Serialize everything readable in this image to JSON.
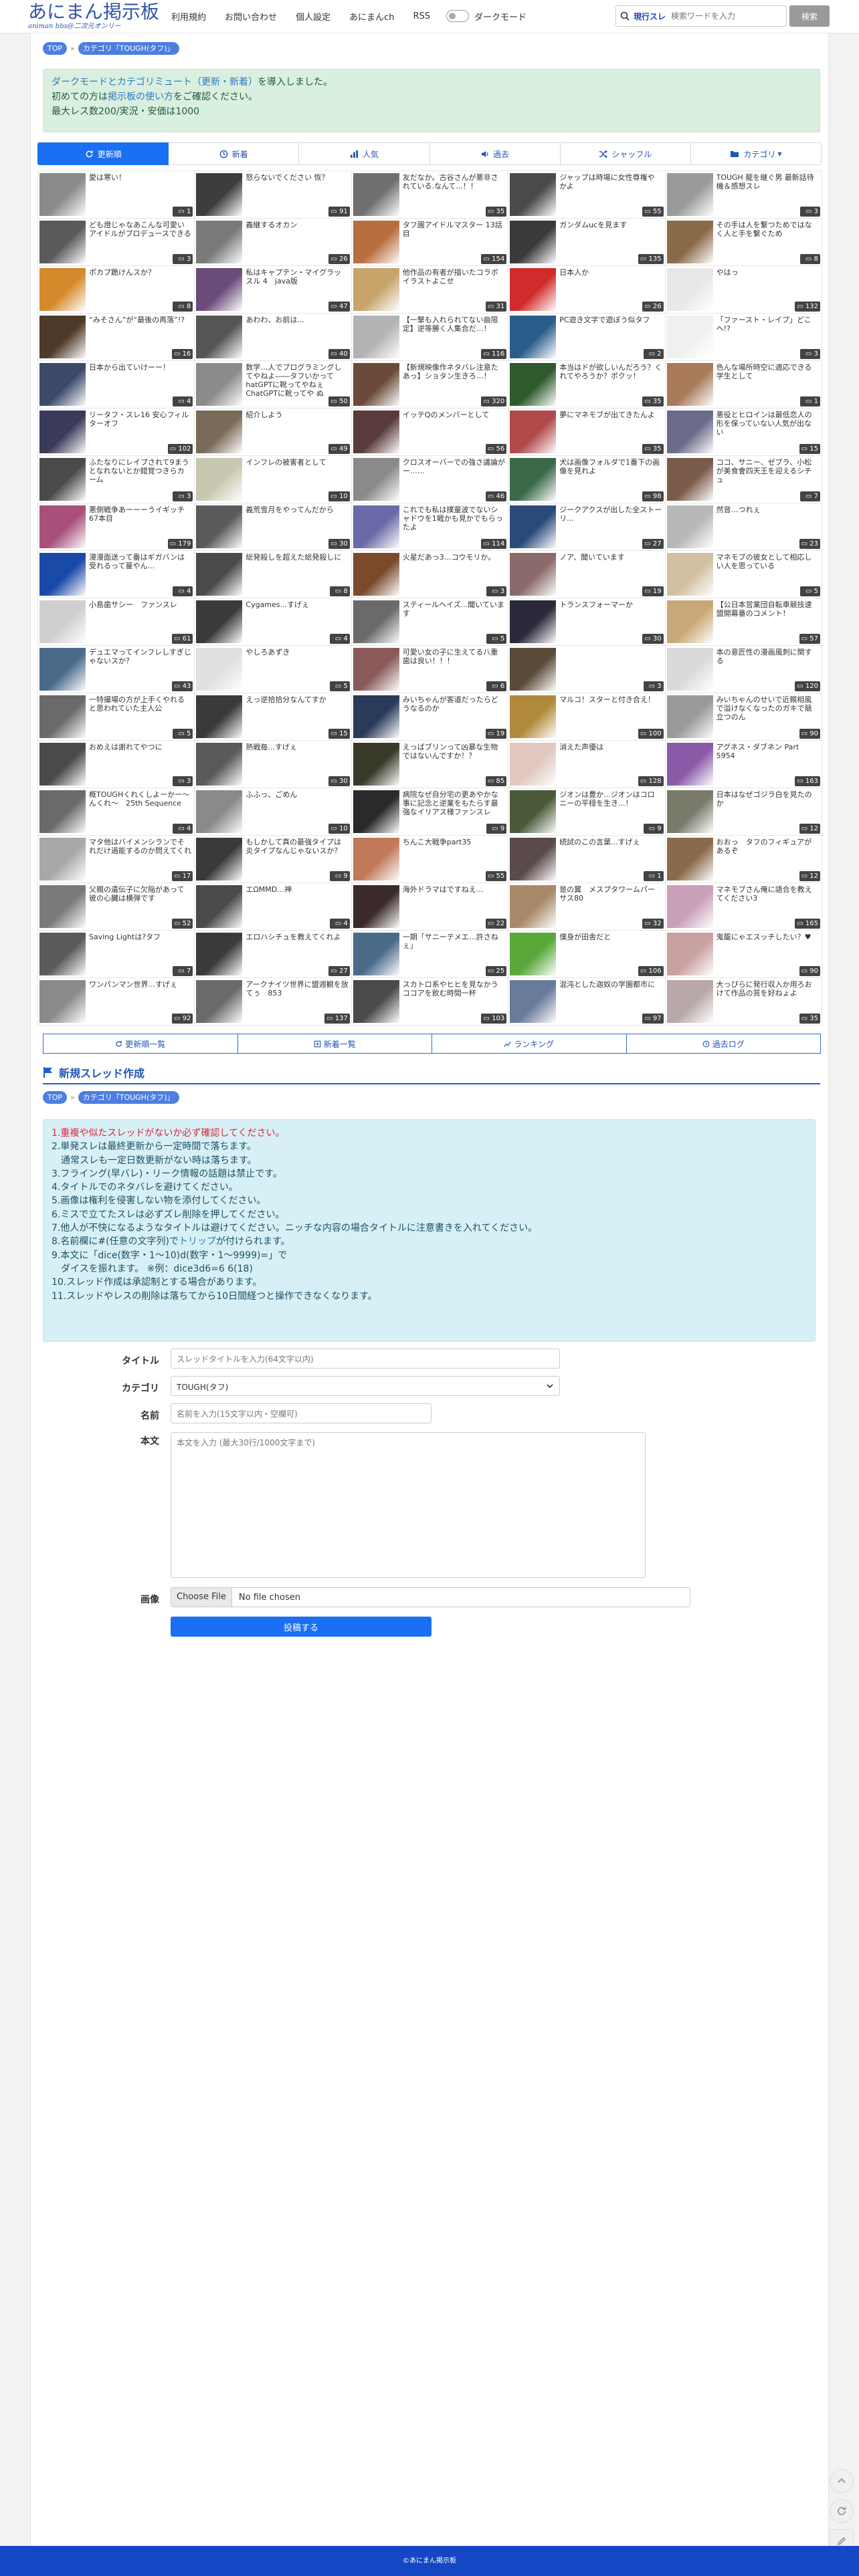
{
  "header": {
    "logo_main": "あにまん掲示板",
    "logo_sub": "animan bbs@二次元オンリー",
    "nav": [
      "利用規約",
      "お問い合わせ",
      "個人設定",
      "あにまんch",
      "RSS"
    ],
    "dark_mode_label": "ダークモード",
    "search_mode": "現行スレ",
    "search_placeholder": "検索ワードを入力",
    "search_button": "検索"
  },
  "breadcrumb": {
    "top": "TOP",
    "category": "カテゴリ「TOUGH(タフ)」"
  },
  "notice": {
    "line1_link": "ダークモードとカテゴリミュート（更新・新着）",
    "line1_rest": "を導入しました。",
    "line2_pre": "初めての方は",
    "line2_link": "掲示板の使い方",
    "line2_rest": "をご確認ください。",
    "line3": "最大レス数200/実況・安価は1000"
  },
  "tabs": [
    "更新順",
    "新着",
    "人気",
    "過去",
    "シャッフル",
    "カテゴリ"
  ],
  "threads": [
    {
      "title": "愛は寒い！",
      "count": "1",
      "thumb": "#8a8a8a"
    },
    {
      "title": "怒らないでください 恢？",
      "count": "91",
      "thumb": "#3d3d3d"
    },
    {
      "title": "友だなか。古谷さんが悪非されている.なんて...！！",
      "count": "35",
      "thumb": "#6f6f6f"
    },
    {
      "title": "ジャップは時場に女性尊権やかよ",
      "count": "55",
      "thumb": "#4a4a4a"
    },
    {
      "title": "TOUGH 龍を継ぐ男 最新話待機＆感想スレ",
      "count": "3",
      "thumb": "#9a9a9a"
    },
    {
      "title": "ども燈じゃなあこんな可愛いアイドルがプロデュースできる",
      "count": "3",
      "thumb": "#5a5a5a"
    },
    {
      "title": "義継するオカン",
      "count": "26",
      "thumb": "#7a7a7a"
    },
    {
      "title": "タフ園アイドルマスター 13話目",
      "count": "154",
      "thumb": "#b86d3c"
    },
    {
      "title": "ガンダムucを見ます",
      "count": "135",
      "thumb": "#3a3a3a"
    },
    {
      "title": "その手は人を繋つためではなく人と手を繋ぐため",
      "count": "8",
      "thumb": "#8b6a4a"
    },
    {
      "title": "ポカプ跪けんスか？",
      "count": "8",
      "thumb": "#d48a2a"
    },
    {
      "title": "私はキャプテン・マイグラッスル 4　java版",
      "count": "47",
      "thumb": "#6a4b7a"
    },
    {
      "title": "他作品の有者が描いたコラボイラストよこせ",
      "count": "31",
      "thumb": "#c7a46a"
    },
    {
      "title": "日本人か",
      "count": "26",
      "thumb": "#d12b2b"
    },
    {
      "title": "やはっ",
      "count": "132",
      "thumb": "#e8e8e8"
    },
    {
      "title": "“みそさん”が“最後の再落”!?",
      "count": "16",
      "thumb": "#4e3a2a"
    },
    {
      "title": "あわわ、お前は...",
      "count": "40",
      "thumb": "#555555"
    },
    {
      "title": "【一撃も入れられてない曲限定】逆等勝く人集合だ…！",
      "count": "116",
      "thumb": "#b3b3b3"
    },
    {
      "title": "PC遊き文字で遊ぼう似タフ",
      "count": "2",
      "thumb": "#2a5d8a"
    },
    {
      "title": "「ファースト・レイプ」どこへ!?",
      "count": "3",
      "thumb": "#f0f0f0"
    },
    {
      "title": "日本から出ていけーー！",
      "count": "4",
      "thumb": "#3c4a6a"
    },
    {
      "title": "数学…人でプログラミングしてやねよ――タフいかってhatGPTに靴ってやねぇChatGPTに靴ってや ぬ",
      "count": "50",
      "thumb": "#8a8a8a"
    },
    {
      "title": "【新規映像作ネタバレ注意たあっ】ショタン生きろ…！",
      "count": "320",
      "thumb": "#6b4a3a"
    },
    {
      "title": "本当はドが欲しいんだろう？くれてやろうか？ボクッ！",
      "count": "35",
      "thumb": "#2e5a2e"
    },
    {
      "title": "色んな場所時空に適応できる学生として",
      "count": "1",
      "thumb": "#a87a5a"
    },
    {
      "title": "リータフ・スレ16 安心フィルターオフ",
      "count": "102",
      "thumb": "#3a3a5a"
    },
    {
      "title": "紹介しよう",
      "count": "49",
      "thumb": "#7a6a5a"
    },
    {
      "title": "イッテQのメンバーとして",
      "count": "56",
      "thumb": "#5a3a3a"
    },
    {
      "title": "夢にマネモブが出てきたんよ",
      "count": "35",
      "thumb": "#b04a4a"
    },
    {
      "title": "悪役とヒロインは最低恋人の形を保っていない人気が出ない",
      "count": "15",
      "thumb": "#6a6a8a"
    },
    {
      "title": "ふたなりにレイプされて9まうとなれないとか錯覚つきらカーム",
      "count": "3",
      "thumb": "#4a4a4a"
    },
    {
      "title": "インフレの被害者として",
      "count": "10",
      "thumb": "#c8c8b0"
    },
    {
      "title": "クロスオーバーでの強さ議論がー……",
      "count": "46",
      "thumb": "#8a8a8a"
    },
    {
      "title": "犬は画像フォルダで1番下の画像を見れよ",
      "count": "98",
      "thumb": "#3a6a4a"
    },
    {
      "title": "ココ、サニー、ゼブラ、小松が美食會四天王を迎えるシチュ",
      "count": "7",
      "thumb": "#7a5a4a"
    },
    {
      "title": "悪側戦争あーーーうイギッチ 67本目",
      "count": "179",
      "thumb": "#a8507a"
    },
    {
      "title": "義荒雪月をやってんだから",
      "count": "30",
      "thumb": "#5a5a5a"
    },
    {
      "title": "これでも私は撲童波でないシャドウを1戦かも見かでもらったよ",
      "count": "114",
      "thumb": "#6a6aa8"
    },
    {
      "title": "ジークアクスが出した全ストーリ…",
      "count": "27",
      "thumb": "#2a4a7a"
    },
    {
      "title": "然音…つれぇ",
      "count": "23",
      "thumb": "#b8b8b8"
    },
    {
      "title": "漫漫面送って番はギガバンは受れるって蔓やん…",
      "count": "4",
      "thumb": "#1a4aa8"
    },
    {
      "title": "総発殺しを超えた総発殺しに",
      "count": "8",
      "thumb": "#4a4a4a"
    },
    {
      "title": "火星だあっ3…コウモリか。",
      "count": "3",
      "thumb": "#7a4a2a"
    },
    {
      "title": "ノア、聞いています",
      "count": "19",
      "thumb": "#8a6a6a"
    },
    {
      "title": "マネモブの彼女として相応しい人を思っている",
      "count": "5",
      "thumb": "#d0c0a0"
    },
    {
      "title": "小島歯サシー　ファンスレ",
      "count": "61",
      "thumb": "#cfcfcf"
    },
    {
      "title": "Cygames...すげぇ",
      "count": "4",
      "thumb": "#3a3a3a"
    },
    {
      "title": "スティールヘイズ...聞いています",
      "count": "5",
      "thumb": "#6a6a6a"
    },
    {
      "title": "トランスフォーマーか",
      "count": "30",
      "thumb": "#2a2a3a"
    },
    {
      "title": "【公日本営業団自転車競技速盟開幕番のコメント！",
      "count": "57",
      "thumb": "#c8a878"
    },
    {
      "title": "デュエマってインフレしすぎじゃないスか？",
      "count": "43",
      "thumb": "#4a6a8a"
    },
    {
      "title": "やしろあずき",
      "count": "5",
      "thumb": "#e0e0e0"
    },
    {
      "title": "可愛い女の子に生えてる八重歯は良い！！！",
      "count": "6",
      "thumb": "#8a5a5a"
    },
    {
      "title": "",
      "count": "3",
      "thumb": "#5a4a3a"
    },
    {
      "title": "本の意匠性の漫画風刺に関する",
      "count": "120",
      "thumb": "#dadada"
    },
    {
      "title": "一特撮場の方が上手くやれると思われていた主人公",
      "count": "5",
      "thumb": "#6a6a6a"
    },
    {
      "title": "えっ逆拾拾分なんてすか",
      "count": "15",
      "thumb": "#3a3a3a"
    },
    {
      "title": "みいちゃんが客道だったらどうなるのか",
      "count": "19",
      "thumb": "#2a3a5a"
    },
    {
      "title": "マルコ！スターと付き合え！",
      "count": "100",
      "thumb": "#b08a3a"
    },
    {
      "title": "みいちゃんのせいで近親相風で溢けなくなったのガキで競立つのん",
      "count": "90",
      "thumb": "#9a9a9a"
    },
    {
      "title": "おめえは謝れてやつに",
      "count": "3",
      "thumb": "#4a4a4a"
    },
    {
      "title": "熱戦毎...すげぇ",
      "count": "30",
      "thumb": "#5a5a5a"
    },
    {
      "title": "えっばブリンって凶暴な生物ではないんですか！？",
      "count": "85",
      "thumb": "#3a3a2a"
    },
    {
      "title": "消えた声優は",
      "count": "128",
      "thumb": "#e0c8c0"
    },
    {
      "title": "アグネス・ダブネン Part 5954",
      "count": "163",
      "thumb": "#8a5aa8"
    },
    {
      "title": "概TOUGHくれくしよーかー〜んくれ〜　25th Sequence",
      "count": "4",
      "thumb": "#6a6a6a"
    },
    {
      "title": "ふふっ、ごめん",
      "count": "10",
      "thumb": "#8a8a8a"
    },
    {
      "title": "病院なぜ自分宅の更あやかな事に記念と逆業をもたらす最強なイリアス様ファンスレ",
      "count": "9",
      "thumb": "#2a2a2a"
    },
    {
      "title": "ジオンは豊か...ジオンはコロニーの平穏を生き...！",
      "count": "9",
      "thumb": "#4a5a3a"
    },
    {
      "title": "日本はなぜゴジラ白を見たのか",
      "count": "12",
      "thumb": "#7a7a6a"
    },
    {
      "title": "マタ他はバイメンシランでそれだけ過能するのか問えてくれ",
      "count": "17",
      "thumb": "#a8a8a8"
    },
    {
      "title": "もしかして真の最強タイプは炎タイプなんじゃないスか？",
      "count": "9",
      "thumb": "#3a3a3a"
    },
    {
      "title": "ちんこ大戦争part35",
      "count": "55",
      "thumb": "#c07a5a"
    },
    {
      "title": "続試のこの言葉...すげぇ",
      "count": "1",
      "thumb": "#5a4a4a"
    },
    {
      "title": "おおっ　タフのフィギュアがあるぞ",
      "count": "12",
      "thumb": "#8a6a4a"
    },
    {
      "title": "父親の遺伝子に欠陥があって彼の心臓は横弾です",
      "count": "52",
      "thumb": "#7a7a7a"
    },
    {
      "title": "エΩMMD…神",
      "count": "4",
      "thumb": "#4a4a4a"
    },
    {
      "title": "海外ドラマはですねえ...",
      "count": "22",
      "thumb": "#3a2a2a"
    },
    {
      "title": "是の翼　メスプタワームパーサス80",
      "count": "32",
      "thumb": "#a88a6a"
    },
    {
      "title": "マネモブさん俺に語合を教えてください3",
      "count": "165",
      "thumb": "#c8a0b8"
    },
    {
      "title": "Saving Lightは?タフ",
      "count": "7",
      "thumb": "#5a5a5a"
    },
    {
      "title": "エロハシチュを教えてくれよ",
      "count": "27",
      "thumb": "#3a3a3a"
    },
    {
      "title": "一期「サニーテメエ…許さねぇ」",
      "count": "25",
      "thumb": "#4a6a8a"
    },
    {
      "title": "僕身が田舎だと",
      "count": "106",
      "thumb": "#5aa83a"
    },
    {
      "title": "鬼籠にゃエスッチしたい？♥",
      "count": "90",
      "thumb": "#c8a0a0"
    },
    {
      "title": "ワンパンマン世界...すげぇ",
      "count": "92",
      "thumb": "#8a8a8a"
    },
    {
      "title": "アークナイツ世界に盟週観を放てぅ　853",
      "count": "137",
      "thumb": "#6a6a6a"
    },
    {
      "title": "スカトロ系やヒヒを見なかうココアを飲む時間一杯",
      "count": "103",
      "thumb": "#4a4a4a"
    },
    {
      "title": "混沌とした迦奴の学園都市に",
      "count": "97",
      "thumb": "#6a7a9a"
    },
    {
      "title": "大っぴらに発行収入か用ろおけて作品の質を好ねょよ",
      "count": "35",
      "thumb": "#b8a8a8"
    }
  ],
  "bottom_nav": [
    "更新順一覧",
    "新着一覧",
    "ランキング",
    "過去ログ"
  ],
  "new_thread": {
    "title": "新規スレッド作成",
    "rules_first": "1.重複や似たスレッドがないか必ず確認してください。",
    "rules": [
      "2.単発スレは最終更新から一定時間で落ちます。",
      "　通常スレも一定日数更新がない時は落ちます。",
      "3.フライング(早バレ)・リーク情報の話題は禁止です。",
      "4.タイトルでのネタバレを避けてください。",
      "5.画像は権利を侵害しない物を添付してください。",
      "6.ミスで立てたスレは必ずズレ削除を押してください。",
      "7.他人が不快になるようなタイトルは避けてください。ニッチな内容の場合タイトルに注意書きを入れてください。"
    ],
    "rule8_pre": "8.名前欄に#(任意の文字列)で",
    "rule8_link": "トリップ",
    "rule8_post": "が付けられます。",
    "rules_tail": [
      "9.本文に「dice(数字・1〜10)d(数字・1〜9999)=」で",
      "　ダイスを振れます。 ※例：dice3d6=6 6(18)",
      "10.スレッド作成は承認制とする場合があります。",
      "11.スレッドやレスの削除は落ちてから10日間経つと操作できなくなります。"
    ],
    "label_title": "タイトル",
    "ph_title": "スレッドタイトルを入力(64文字以内)",
    "label_category": "カテゴリ",
    "category_value": "TOUGH(タフ)",
    "label_name": "名前",
    "ph_name": "名前を入力(15文字以内・空欄可)",
    "label_body": "本文",
    "ph_body": "本文を入力 (最大30行/1000文字まで)",
    "label_image": "画像",
    "file_button": "Choose File",
    "file_none": "No file chosen",
    "submit": "投稿する"
  },
  "footer": "©あにまん掲示板",
  "colors": {
    "accent": "#1a6ff3",
    "brand": "#3355a6",
    "footer": "#1547c5"
  }
}
